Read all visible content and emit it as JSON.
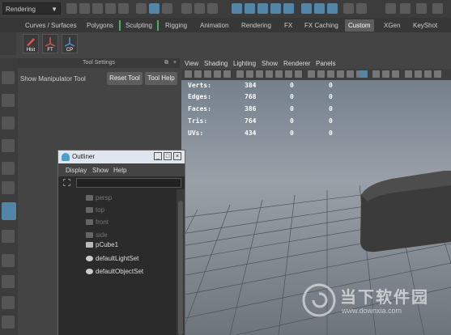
{
  "statusline": {
    "menu_set": "Rendering",
    "menu_set_arrow": "▼",
    "icons": [
      "new-scene-icon",
      "open-scene-icon",
      "save-scene-icon",
      "undo-icon",
      "redo-icon",
      "select-hierarchy-icon",
      "select-object-icon",
      "select-component-icon",
      "snap-grid-icon",
      "snap-curve-icon",
      "snap-point-icon",
      "snap-view-icon",
      "snap-surface-icon",
      "construction-history-icon",
      "render-icon",
      "ipr-render-icon",
      "render-settings-icon",
      "hypershade-icon",
      "lock-icon",
      "toggle-icon",
      "panel-icon-1",
      "panel-icon-2",
      "panel-icon-3",
      "panel-icon-4"
    ]
  },
  "shelf_tabs": {
    "items": [
      {
        "label": "Curves / Surfaces"
      },
      {
        "label": "Polygons"
      },
      {
        "label": "Sculpting"
      },
      {
        "label": "Rigging"
      },
      {
        "label": "Animation"
      },
      {
        "label": "Rendering"
      },
      {
        "label": "FX"
      },
      {
        "label": "FX Caching"
      },
      {
        "label": "Custom"
      },
      {
        "label": "XGen"
      },
      {
        "label": "KeyShot"
      }
    ],
    "active": "Custom"
  },
  "shelf": {
    "buttons": [
      {
        "label": "Hist"
      },
      {
        "label": "FT"
      },
      {
        "label": "CP"
      }
    ]
  },
  "tool_settings": {
    "title": "Tool Settings",
    "tool_name": "Show Manipulator Tool",
    "reset_label": "Reset Tool",
    "help_label": "Tool Help"
  },
  "viewport": {
    "menus": [
      "View",
      "Shading",
      "Lighting",
      "Show",
      "Renderer",
      "Panels"
    ],
    "hud": [
      {
        "label": "Verts:",
        "v1": "384",
        "v2": "0",
        "v3": "0"
      },
      {
        "label": "Edges:",
        "v1": "768",
        "v2": "0",
        "v3": "0"
      },
      {
        "label": "Faces:",
        "v1": "386",
        "v2": "0",
        "v3": "0"
      },
      {
        "label": "Tris:",
        "v1": "764",
        "v2": "0",
        "v3": "0"
      },
      {
        "label": "UVs:",
        "v1": "434",
        "v2": "0",
        "v3": "0"
      }
    ]
  },
  "outliner": {
    "title": "Outliner",
    "window_buttons": [
      "_",
      "□",
      "×"
    ],
    "menus": [
      "Display",
      "Show",
      "Help"
    ],
    "items": [
      {
        "label": "persp"
      },
      {
        "label": "top"
      },
      {
        "label": "front"
      },
      {
        "label": "side"
      },
      {
        "label": "pCube1"
      },
      {
        "label": "defaultLightSet"
      },
      {
        "label": "defaultObjectSet"
      }
    ]
  },
  "watermark": {
    "brand": "当下软件园",
    "url": "www.downxia.com"
  },
  "colors": {
    "highlight": "#5285a6",
    "panel": "#444444",
    "dark": "#2b2b2b"
  }
}
